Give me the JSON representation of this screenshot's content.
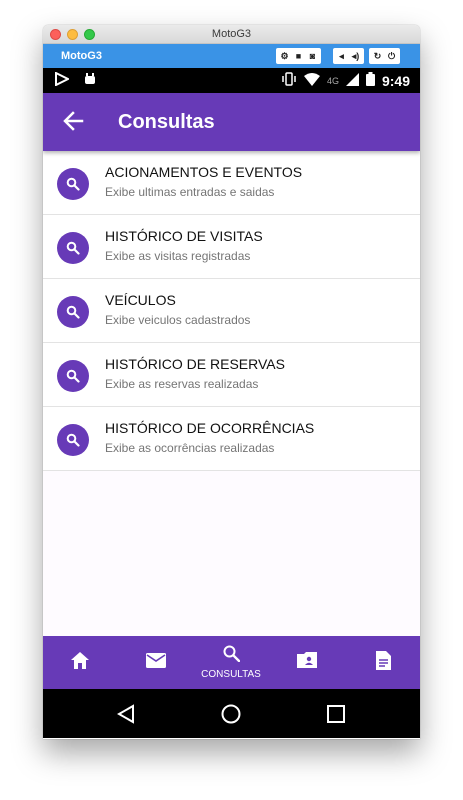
{
  "window": {
    "title": "MotoG3"
  },
  "emulator": {
    "device_name": "MotoG3"
  },
  "statusbar": {
    "time": "9:49",
    "network": "4G"
  },
  "appbar": {
    "title": "Consultas"
  },
  "list": [
    {
      "title": "ACIONAMENTOS E EVENTOS",
      "subtitle": "Exibe ultimas entradas e saidas"
    },
    {
      "title": "HISTÓRICO DE VISITAS",
      "subtitle": "Exibe as visitas registradas"
    },
    {
      "title": "VEÍCULOS",
      "subtitle": "Exibe veiculos cadastrados"
    },
    {
      "title": "HISTÓRICO DE RESERVAS",
      "subtitle": "Exibe as reservas realizadas"
    },
    {
      "title": "HISTÓRICO DE OCORRÊNCIAS",
      "subtitle": "Exibe as ocorrências realizadas"
    }
  ],
  "bottomnav": {
    "items": [
      {
        "icon": "home-icon"
      },
      {
        "icon": "mail-icon"
      },
      {
        "icon": "search-icon",
        "label": "CONSULTAS",
        "active": true
      },
      {
        "icon": "contacts-icon"
      },
      {
        "icon": "document-icon"
      }
    ]
  },
  "colors": {
    "primary": "#673ab7",
    "emulator_bar": "#3a93e6"
  }
}
